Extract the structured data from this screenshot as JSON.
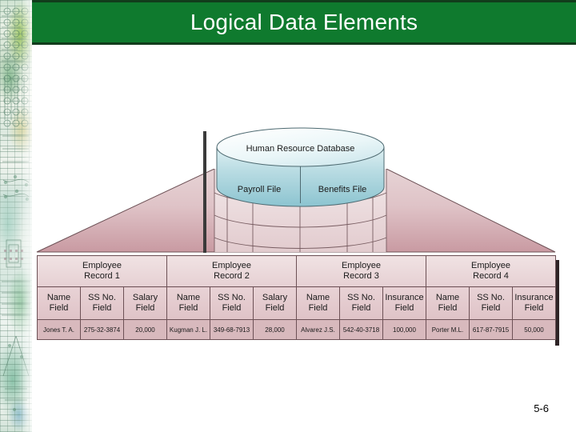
{
  "slide": {
    "title": "Logical Data Elements",
    "title_bar_color": "#0f7a2e",
    "page_number": "5-6"
  },
  "diagram": {
    "database": {
      "title": "Human Resource Database",
      "files": [
        {
          "label": "Payroll File"
        },
        {
          "label": "Benefits File"
        }
      ]
    },
    "records": [
      {
        "header": "Employee\nRecord 1",
        "header_line1": "Employee",
        "header_line2": "Record 1",
        "fields": [
          {
            "label_line1": "Name",
            "label_line2": "Field",
            "value": "Jones T. A."
          },
          {
            "label_line1": "SS No.",
            "label_line2": "Field",
            "value": "275-32-3874"
          },
          {
            "label_line1": "Salary",
            "label_line2": "Field",
            "value": "20,000"
          }
        ]
      },
      {
        "header_line1": "Employee",
        "header_line2": "Record 2",
        "fields": [
          {
            "label_line1": "Name",
            "label_line2": "Field",
            "value": "Kugman J. L."
          },
          {
            "label_line1": "SS No.",
            "label_line2": "Field",
            "value": "349-68-7913"
          },
          {
            "label_line1": "Salary",
            "label_line2": "Field",
            "value": "28,000"
          }
        ]
      },
      {
        "header_line1": "Employee",
        "header_line2": "Record 3",
        "fields": [
          {
            "label_line1": "Name",
            "label_line2": "Field",
            "value": "Alvarez J.S."
          },
          {
            "label_line1": "SS No.",
            "label_line2": "Field",
            "value": "542-40-3718"
          },
          {
            "label_line1": "Insurance",
            "label_line2": "Field",
            "value": "100,000"
          }
        ]
      },
      {
        "header_line1": "Employee",
        "header_line2": "Record 4",
        "fields": [
          {
            "label_line1": "Name",
            "label_line2": "Field",
            "value": "Porter M.L."
          },
          {
            "label_line1": "SS No.",
            "label_line2": "Field",
            "value": "617-87-7915"
          },
          {
            "label_line1": "Insurance",
            "label_line2": "Field",
            "value": "50,000"
          }
        ]
      }
    ]
  }
}
